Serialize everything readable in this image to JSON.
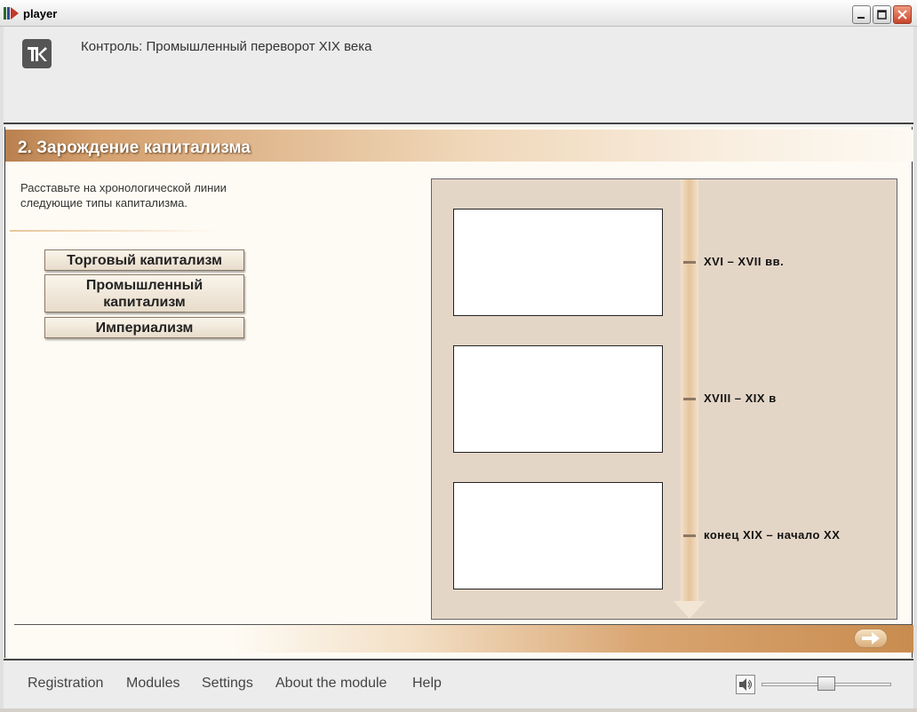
{
  "window": {
    "title": "player",
    "buttons": [
      "minimize",
      "maximize",
      "close"
    ]
  },
  "header": {
    "logo_icon": "k-logo-icon",
    "title": "Контроль: Промышленный переворот XIX века"
  },
  "section": {
    "title": "2. Зарождение капитализма"
  },
  "task": {
    "instructions": "Расставьте на хронологической линии следующие типы капитализма."
  },
  "options": [
    {
      "label": "Торговый капитализм"
    },
    {
      "label": "Промышленный капитализм"
    },
    {
      "label": "Империализм"
    }
  ],
  "timeline": {
    "periods": [
      {
        "label": "XVI – XVII вв."
      },
      {
        "label": "XVIII – XIX в"
      },
      {
        "label": "конец XIX – начало XX"
      }
    ]
  },
  "navigation": {
    "next_icon": "arrow-right-icon"
  },
  "footer": {
    "menu": [
      {
        "label": "Registration"
      },
      {
        "label": "Modules"
      },
      {
        "label": "Settings"
      },
      {
        "label": "About the module"
      },
      {
        "label": "Help"
      }
    ],
    "volume_icon": "speaker-icon",
    "volume_level": 0.5
  },
  "colors": {
    "accent": "#c98c4f",
    "panel": "#e4d6c7",
    "content_bg": "#fefbf4"
  }
}
